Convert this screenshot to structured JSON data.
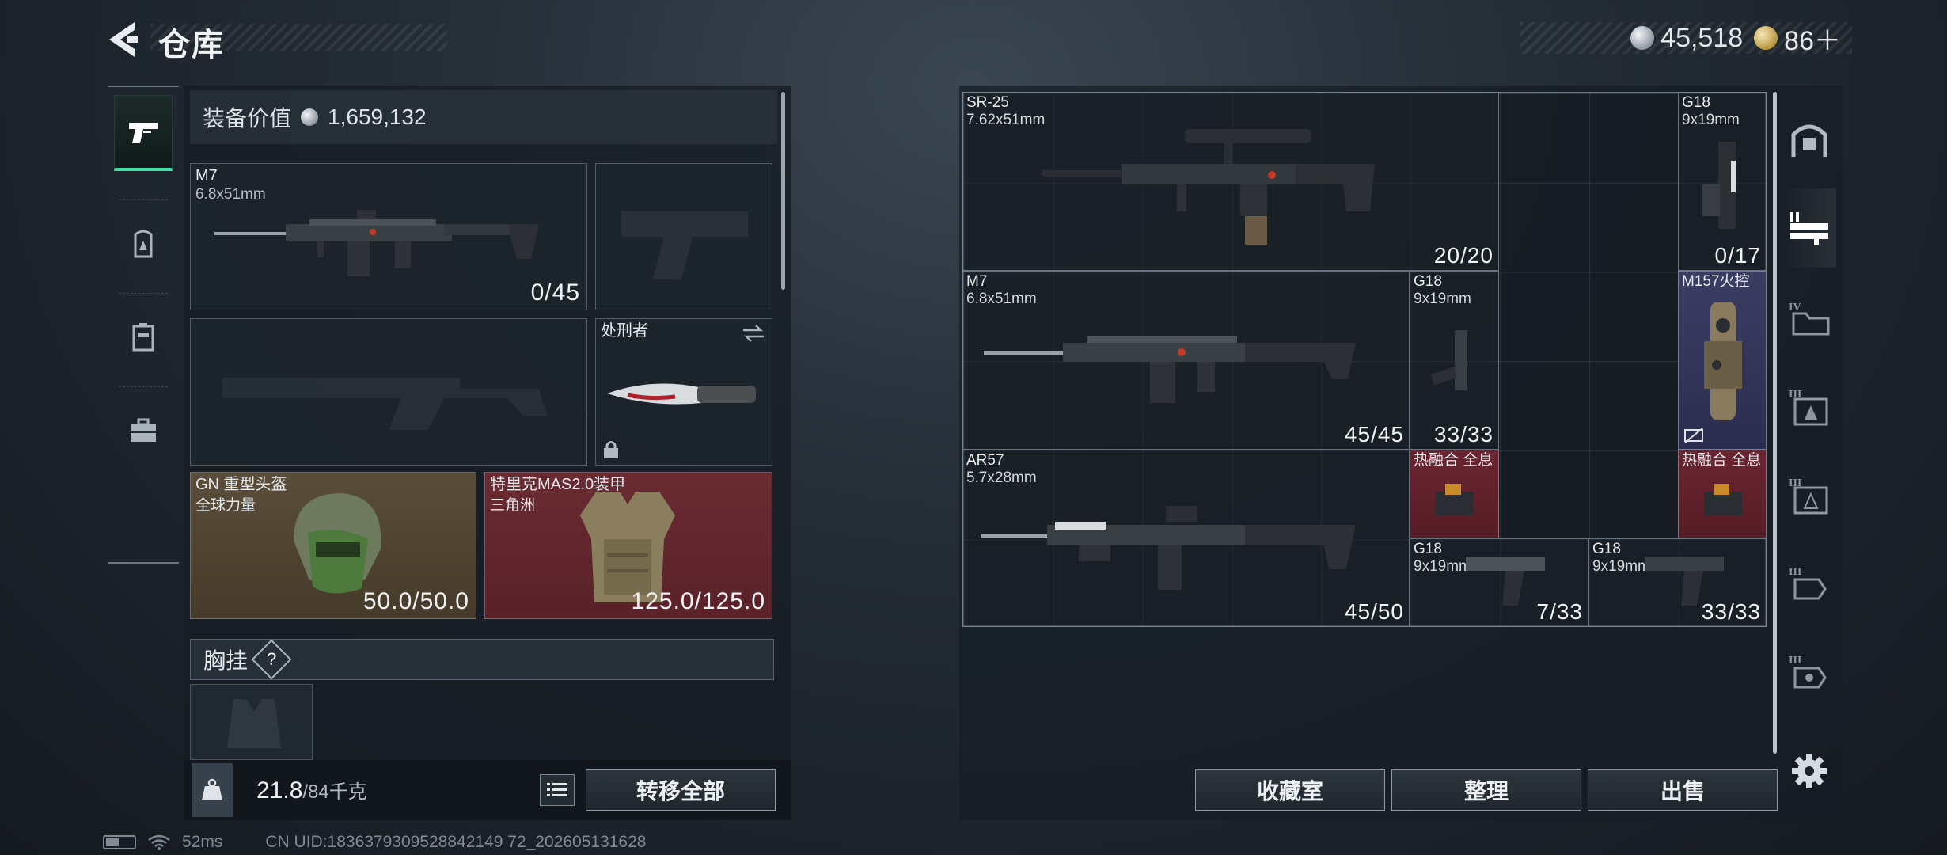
{
  "header": {
    "title": "仓库",
    "currency": [
      {
        "icon": "silver-coin-icon",
        "value": "45,518"
      },
      {
        "icon": "gold-coin-icon",
        "value": "86＋"
      }
    ]
  },
  "left_tabs": [
    {
      "icon": "pistol-icon",
      "active": true
    },
    {
      "icon": "backpack-icon",
      "active": false
    },
    {
      "icon": "vest-icon",
      "active": false
    },
    {
      "icon": "toolbox-icon",
      "active": false
    }
  ],
  "loadout": {
    "value_label": "装备价值",
    "value": "1,659,132",
    "primary": {
      "name": "M7",
      "caliber": "6.8x51mm",
      "count": "0/45"
    },
    "melee": {
      "name": "处刑者"
    },
    "helmet": {
      "name": "GN 重型头盔",
      "sub": "全球力量",
      "durability": "50.0/50.0"
    },
    "armor": {
      "name": "特里克MAS2.0装甲",
      "sub": "三角洲",
      "durability": "125.0/125.0"
    },
    "rig_label": "胸挂",
    "rig_help": "?"
  },
  "bottom": {
    "weight": "21.8",
    "weight_max": "/84千克",
    "transfer_all": "转移全部"
  },
  "storage": {
    "items": [
      {
        "name": "SR-25",
        "caliber": "7.62x51mm",
        "count": "20/20"
      },
      {
        "name": "G18",
        "caliber": "9x19mm",
        "count": "0/17"
      },
      {
        "name": "M7",
        "caliber": "6.8x51mm",
        "count": "45/45"
      },
      {
        "name": "G18",
        "caliber": "9x19mm",
        "count": "33/33"
      },
      {
        "name": "M157火控",
        "caliber": "",
        "count": ""
      },
      {
        "name": "AR57",
        "caliber": "5.7x28mm",
        "count": "45/50"
      },
      {
        "name": "热融合 全息",
        "caliber": "",
        "count": ""
      },
      {
        "name": "热融合 全息",
        "caliber": "",
        "count": ""
      },
      {
        "name": "G18",
        "caliber": "9x19mm",
        "count": "7/33"
      },
      {
        "name": "G18",
        "caliber": "9x19mm",
        "count": "33/33"
      }
    ],
    "buttons": {
      "collection": "收藏室",
      "sort": "整理",
      "sell": "出售"
    }
  },
  "right_tabs": [
    {
      "icon": "safe-box-icon",
      "label": ""
    },
    {
      "icon": "weapon-rack-icon",
      "label": "II"
    },
    {
      "icon": "folder-icon",
      "label": "IV"
    },
    {
      "icon": "storage-a-icon",
      "label": "III"
    },
    {
      "icon": "storage-b-icon",
      "label": "III"
    },
    {
      "icon": "storage-c-icon",
      "label": "III"
    },
    {
      "icon": "storage-d-icon",
      "label": "III"
    }
  ],
  "status": {
    "ping": "52ms",
    "uid": "CN UID:1836379309528842149 72_202605131628"
  }
}
